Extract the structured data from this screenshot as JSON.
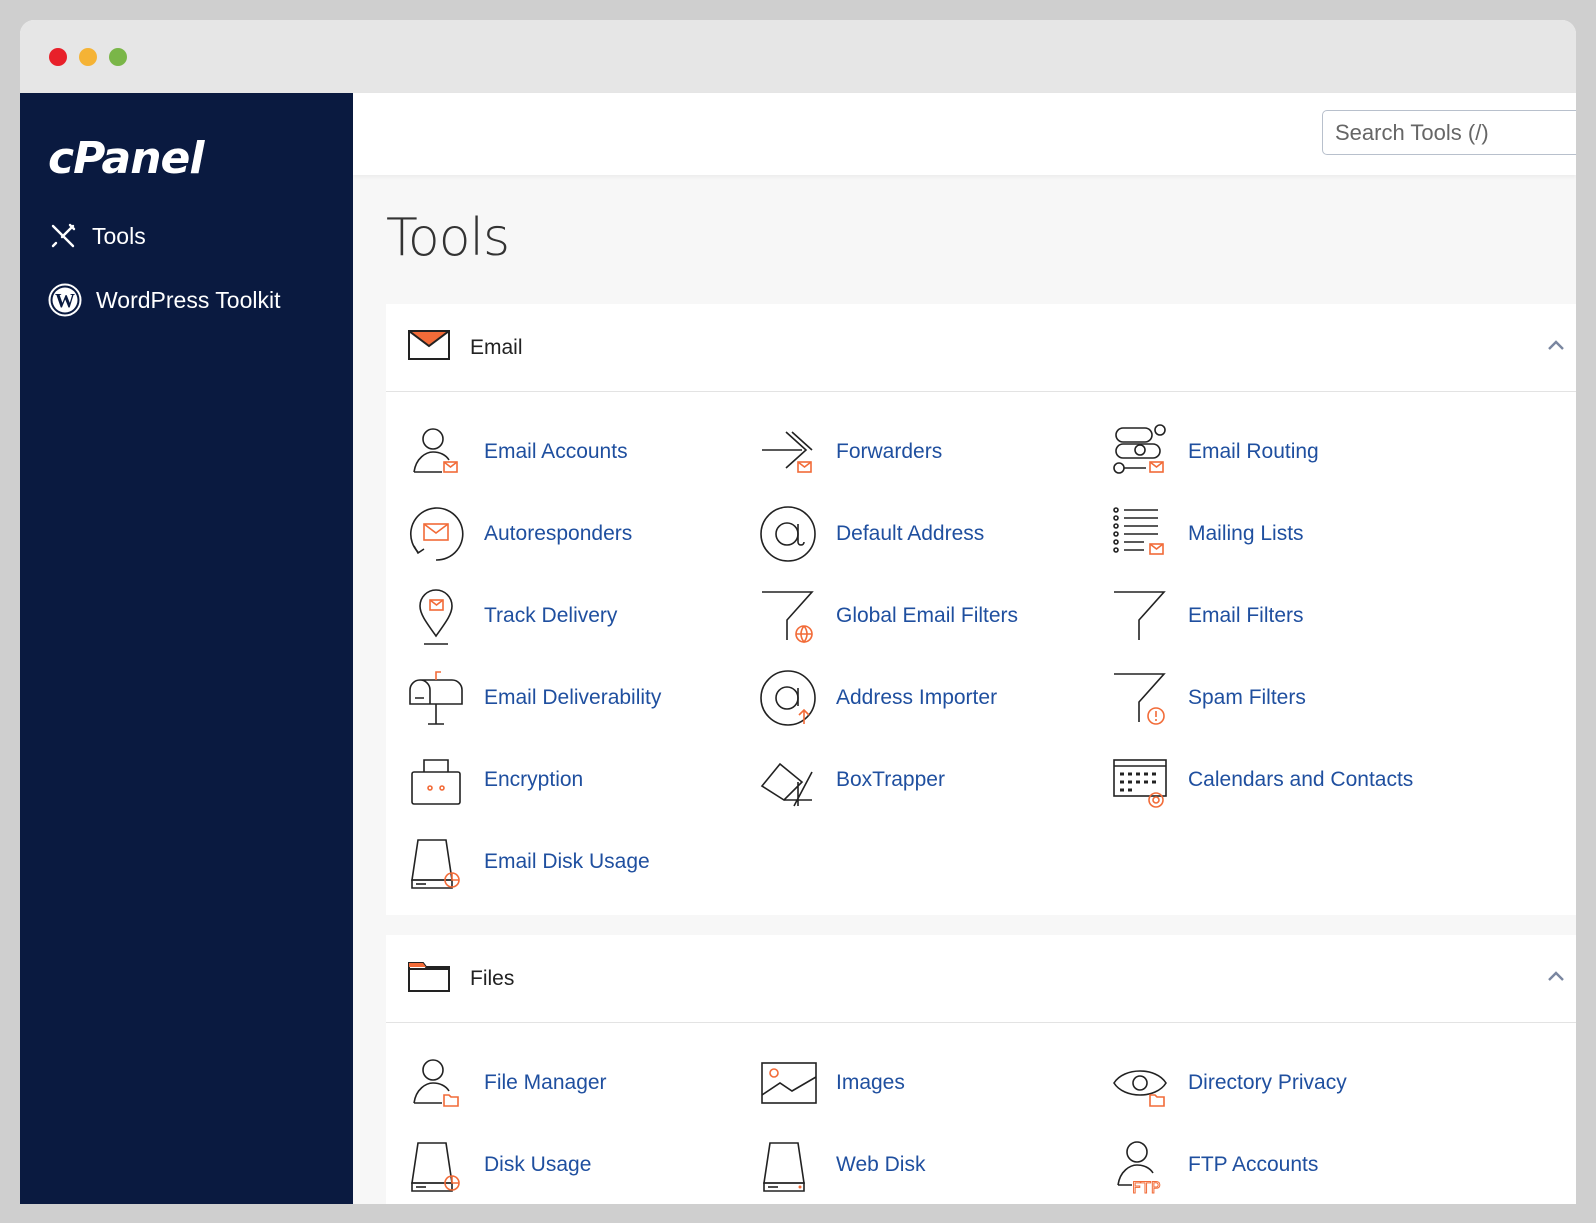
{
  "window": {
    "controls": [
      "close",
      "minimize",
      "maximize"
    ],
    "colors": {
      "close": "#e8202a",
      "minimize": "#f5b335",
      "maximize": "#7ab648"
    }
  },
  "sidebar": {
    "logo": "cPanel",
    "items": [
      {
        "label": "Tools",
        "icon": "tools-icon"
      },
      {
        "label": "WordPress Toolkit",
        "icon": "wordpress-icon"
      }
    ]
  },
  "header": {
    "search_placeholder": "Search Tools (/)"
  },
  "main": {
    "title": "Tools",
    "sections": [
      {
        "title": "Email",
        "icon": "envelope-icon",
        "expanded": true,
        "tools": [
          {
            "label": "Email Accounts",
            "icon": "user-mail"
          },
          {
            "label": "Forwarders",
            "icon": "forward-mail"
          },
          {
            "label": "Email Routing",
            "icon": "routing-mail"
          },
          {
            "label": "Autoresponders",
            "icon": "autoresponder"
          },
          {
            "label": "Default Address",
            "icon": "at"
          },
          {
            "label": "Mailing Lists",
            "icon": "list-mail"
          },
          {
            "label": "Track Delivery",
            "icon": "pin-mail"
          },
          {
            "label": "Global Email Filters",
            "icon": "filter-globe"
          },
          {
            "label": "Email Filters",
            "icon": "filter"
          },
          {
            "label": "Email Deliverability",
            "icon": "mailbox"
          },
          {
            "label": "Address Importer",
            "icon": "at-up"
          },
          {
            "label": "Spam Filters",
            "icon": "filter-alert"
          },
          {
            "label": "Encryption",
            "icon": "lock-box"
          },
          {
            "label": "BoxTrapper",
            "icon": "boxtrapper"
          },
          {
            "label": "Calendars and Contacts",
            "icon": "calendar-at"
          },
          {
            "label": "Email Disk Usage",
            "icon": "disk-pie"
          }
        ]
      },
      {
        "title": "Files",
        "icon": "folder-icon",
        "expanded": true,
        "tools": [
          {
            "label": "File Manager",
            "icon": "user-folder"
          },
          {
            "label": "Images",
            "icon": "image"
          },
          {
            "label": "Directory Privacy",
            "icon": "eye-folder"
          },
          {
            "label": "Disk Usage",
            "icon": "disk-pie"
          },
          {
            "label": "Web Disk",
            "icon": "disk"
          },
          {
            "label": "FTP Accounts",
            "icon": "user-ftp"
          }
        ]
      }
    ]
  },
  "colors": {
    "sidebar": "#0a1a40",
    "link": "#1f4f9f",
    "accent": "#f26b38"
  }
}
